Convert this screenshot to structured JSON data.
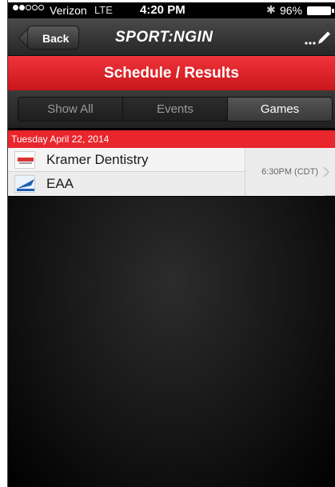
{
  "status_bar": {
    "carrier": "Verizon",
    "network": "LTE",
    "time": "4:20 PM",
    "battery": "96%",
    "signal_bars_filled": 2,
    "signal_bars_total": 5
  },
  "nav": {
    "back_label": "Back",
    "logo_text": "SPORT:NGIN",
    "edit_icon": "edit-pencil-icon"
  },
  "title": "Schedule / Results",
  "segments": [
    {
      "label": "Show All",
      "active": false
    },
    {
      "label": "Events",
      "active": false
    },
    {
      "label": "Games",
      "active": true
    }
  ],
  "date_header": "Tuesday April 22, 2014",
  "game": {
    "home_team": "Kramer Dentistry",
    "home_logo": "kramer-logo",
    "away_team": "EAA",
    "away_logo": "eaa-logo",
    "time": "6:30PM (CDT)"
  },
  "colors": {
    "accent_red": "#e8262c",
    "nav_dark": "#2d2d2d"
  }
}
